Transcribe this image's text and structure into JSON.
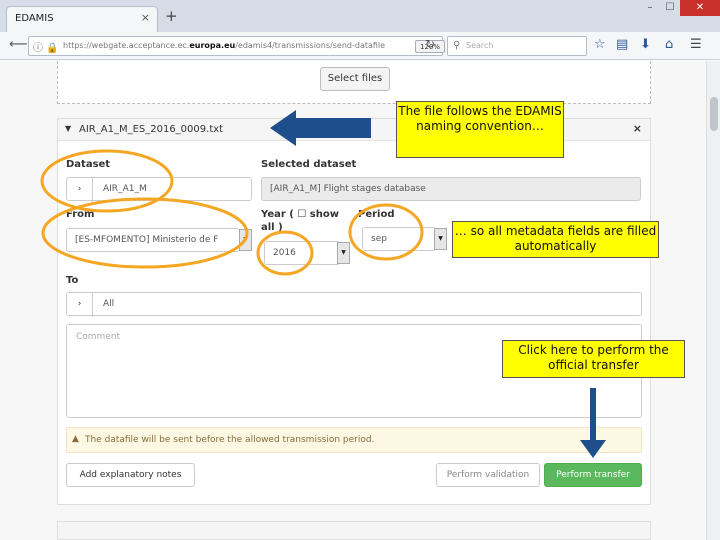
{
  "browser": {
    "tab_title": "EDAMIS",
    "tab_close": "×",
    "new_tab": "+",
    "window_controls": {
      "minimize": "–",
      "maximize": "☐",
      "close": "✕"
    },
    "url_prefix": "https://webgate.acceptance.ec.",
    "url_domain": "europa.eu",
    "url_suffix": "/edamis4/transmissions/send-datafile",
    "zoom": "120%",
    "search_placeholder": "Search"
  },
  "page": {
    "select_files_label": "Select files",
    "panel_title": "AIR_A1_M_ES_2016_0009.txt",
    "panel_close": "×",
    "dataset_label": "Dataset",
    "dataset_value": "AIR_A1_M",
    "selected_dataset_label": "Selected dataset",
    "selected_dataset_value": "[AIR_A1_M] Flight stages database",
    "from_label": "From",
    "from_value": "[ES-MFOMENTO] Ministerio de F",
    "year_label_line1": "Year (",
    "year_show_label": "show",
    "year_label_line2": "all )",
    "year_value": "2016",
    "period_label": "Period",
    "period_value": "sep",
    "to_label": "To",
    "to_value": "All",
    "comment_placeholder": "Comment",
    "warning_text": "The datafile will be sent before the allowed transmission period.",
    "add_notes_button": "Add explanatory notes",
    "validation_button": "Perform validation",
    "transfer_button": "Perform transfer"
  },
  "annotations": {
    "callout_1": "The file follows the EDAMIS naming convention…",
    "callout_2": "… so all metadata fields are filled automatically",
    "callout_3": "Click here to perform the official transfer"
  },
  "colors": {
    "highlight_circle": "#f5a623",
    "arrow": "#1f4e8c",
    "callout_bg": "#ffff00",
    "success": "#5cb85c"
  }
}
